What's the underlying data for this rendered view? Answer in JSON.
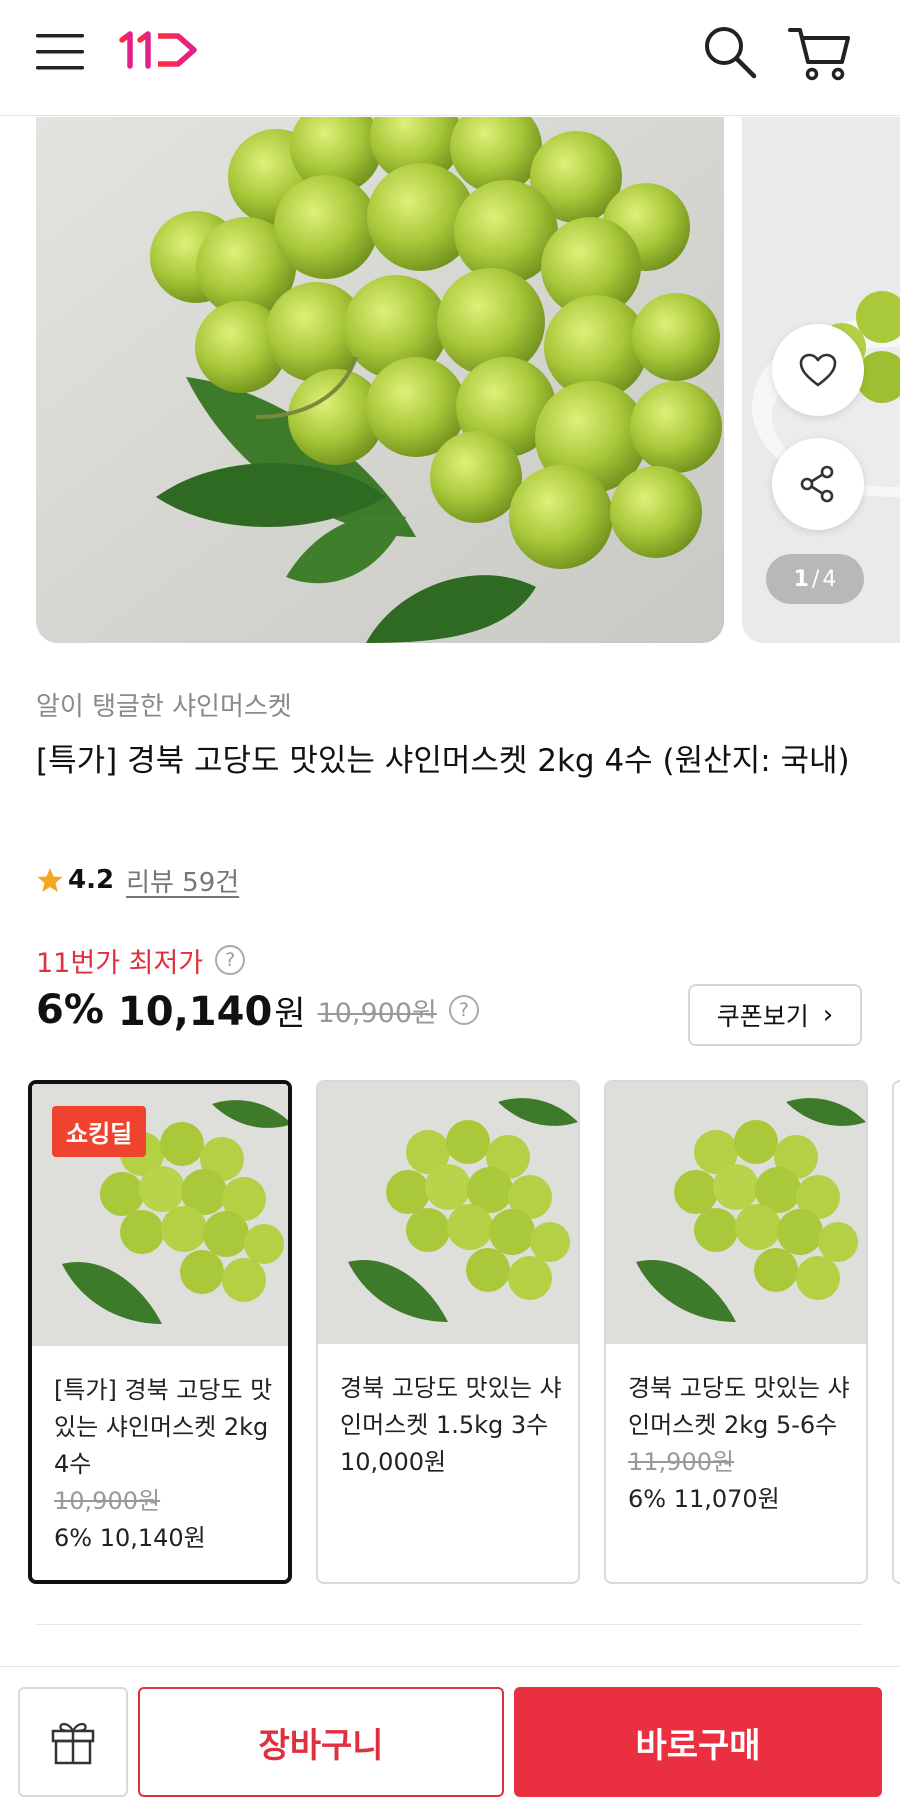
{
  "header": {
    "menu_icon": "hamburger-menu-icon",
    "logo_text": "11",
    "search_icon": "search-icon",
    "cart_icon": "cart-icon"
  },
  "gallery": {
    "current_page": "1",
    "separator": "/",
    "total_pages": "4",
    "wish_icon": "heart-icon",
    "share_icon": "share-icon"
  },
  "product": {
    "subtitle": "알이 탱글한 샤인머스켓",
    "title": "[특가] 경북 고당도 맛있는 샤인머스켓 2kg 4수 (원산지: 국내)",
    "rating": "4.2",
    "review_label": "리뷰 59건",
    "lowest_price_label": "11번가 최저가",
    "discount": "6%",
    "price": "10,140",
    "price_unit": "원",
    "original_price": "10,900원",
    "help_glyph": "?",
    "coupon_label": "쿠폰보기"
  },
  "options": [
    {
      "badge": "쇼킹딜",
      "name": "[특가] 경북 고당도 맛있는 샤인머스켓 2kg 4수",
      "original_price": "10,900원",
      "price": "6% 10,140원",
      "selected": true
    },
    {
      "badge": "",
      "name": "경북 고당도 맛있는 샤인머스켓 1.5kg 3수",
      "original_price": "",
      "price": "10,000원",
      "selected": false
    },
    {
      "badge": "",
      "name": "경북 고당도 맛있는 샤인머스켓 2kg 5-6수",
      "original_price": "11,900원",
      "price": "6% 11,070원",
      "selected": false
    }
  ],
  "bottom_bar": {
    "gift_icon": "gift-icon",
    "cart_label": "장바구니",
    "buy_label": "바로구매"
  },
  "colors": {
    "accent": "#ea2f40",
    "badge": "#f0432f",
    "grape": "#a9c83a"
  }
}
